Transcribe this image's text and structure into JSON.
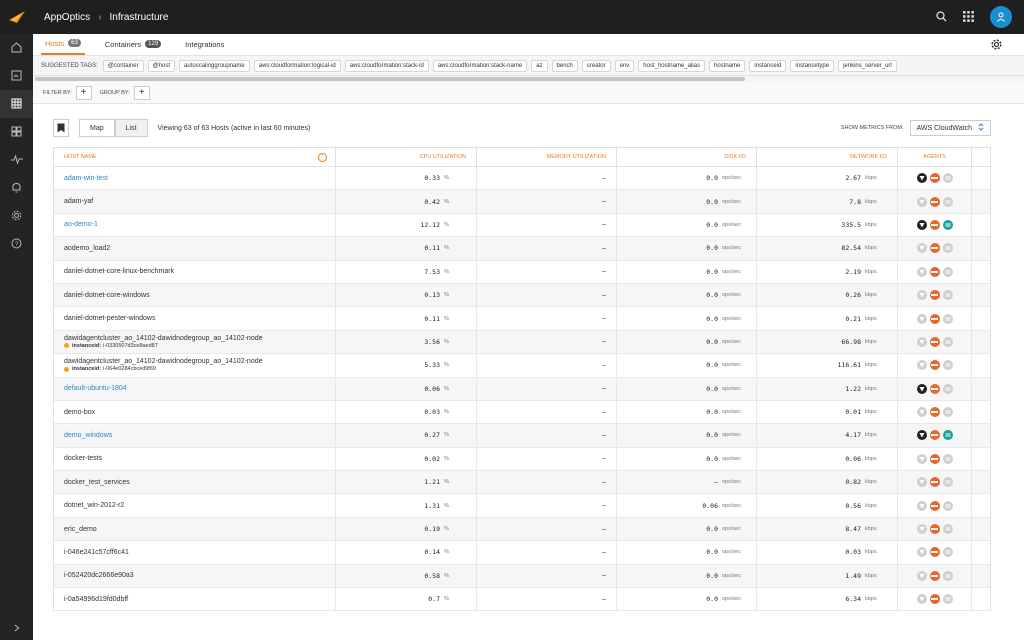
{
  "topbar": {
    "app_name": "AppOptics",
    "breadcrumb": "Infrastructure"
  },
  "colors": {
    "accent": "#e67e22",
    "link": "#2b87c9",
    "avatar": "#1a8fd0",
    "aws_agent": "#e8662c",
    "sw_agent": "#15a39a"
  },
  "sidebar": {
    "items": [
      "home-icon",
      "dashboard-icon",
      "infrastructure-icon",
      "services-icon",
      "metrics-icon",
      "alerts-icon",
      "settings-icon",
      "help-icon"
    ]
  },
  "tabs": [
    {
      "label": "Hosts",
      "count": "63"
    },
    {
      "label": "Containers",
      "count": "129"
    },
    {
      "label": "Integrations"
    }
  ],
  "tags": {
    "label": "SUGGESTED TAGS:",
    "items": [
      "@container",
      "@host",
      "autoscalinggroupname",
      "aws:cloudformation:logical-id",
      "aws:cloudformation:stack-id",
      "aws:cloudformation:stack-name",
      "az",
      "bench",
      "creator",
      "env",
      "host_hostname_alias",
      "hostname",
      "instanceid",
      "instancetype",
      "jenkins_server_url"
    ]
  },
  "filter": {
    "filter_label": "FILTER BY:",
    "group_label": "GROUP BY:",
    "plus": "+"
  },
  "toolbar": {
    "map_label": "Map",
    "list_label": "List",
    "summary": "Viewing 63 of 63 Hosts (active in last 60 minutes)",
    "metrics_label": "SHOW METRICS FROM:",
    "metrics_value": "AWS CloudWatch"
  },
  "table": {
    "headers": {
      "host": "HOST NAME",
      "cpu": "CPU UTILIZATION",
      "mem": "MEMORY UTILIZATION",
      "disk": "DISK I/O",
      "net": "NETWORK I/O",
      "agents": "AGENTS"
    },
    "rows": [
      {
        "name": "adam-win-test",
        "link": true,
        "cpu": "0.33",
        "cpu_unit": "%",
        "mem": "–",
        "disk": "0.0",
        "disk_unit": "ops/sec",
        "net": "2.67",
        "net_unit": "kbps",
        "agents": [
          "linux-on",
          "aws",
          "sw-off"
        ]
      },
      {
        "name": "adam-yaf",
        "link": false,
        "cpu": "0.42",
        "cpu_unit": "%",
        "mem": "–",
        "disk": "0.0",
        "disk_unit": "ops/sec",
        "net": "7.8",
        "net_unit": "kbps",
        "agents": [
          "linux-off",
          "aws",
          "sw-off"
        ]
      },
      {
        "name": "ao-demo-1",
        "link": true,
        "cpu": "12.12",
        "cpu_unit": "%",
        "mem": "–",
        "disk": "0.0",
        "disk_unit": "ops/sec",
        "net": "335.5",
        "net_unit": "kbps",
        "agents": [
          "linux-on",
          "aws",
          "sw-on"
        ]
      },
      {
        "name": "aodemo_load2",
        "link": false,
        "cpu": "0.11",
        "cpu_unit": "%",
        "mem": "–",
        "disk": "0.0",
        "disk_unit": "ops/sec",
        "net": "82.54",
        "net_unit": "kbps",
        "agents": [
          "linux-off",
          "aws",
          "sw-off"
        ]
      },
      {
        "name": "daniel-dotnet-core-linux-benchmark",
        "link": false,
        "cpu": "7.53",
        "cpu_unit": "%",
        "mem": "–",
        "disk": "0.0",
        "disk_unit": "ops/sec",
        "net": "2.19",
        "net_unit": "kbps",
        "agents": [
          "linux-off",
          "aws",
          "sw-off"
        ]
      },
      {
        "name": "daniel-dotnet-core-windows",
        "link": false,
        "cpu": "0.13",
        "cpu_unit": "%",
        "mem": "–",
        "disk": "0.0",
        "disk_unit": "ops/sec",
        "net": "0.26",
        "net_unit": "kbps",
        "agents": [
          "linux-off",
          "aws",
          "sw-off"
        ]
      },
      {
        "name": "daniel-dotnet-pester-windows",
        "link": false,
        "cpu": "0.11",
        "cpu_unit": "%",
        "mem": "–",
        "disk": "0.0",
        "disk_unit": "ops/sec",
        "net": "0.21",
        "net_unit": "kbps",
        "agents": [
          "linux-off",
          "aws",
          "sw-off"
        ]
      },
      {
        "name": "dawidagentcluster_ao_14102-dawidnodegroup_ao_14102-node",
        "link": false,
        "sub_key": "instanceid:",
        "sub_val": "i-0330507d3ce8aed87",
        "cpu": "3.56",
        "cpu_unit": "%",
        "mem": "–",
        "disk": "0.0",
        "disk_unit": "ops/sec",
        "net": "66.98",
        "net_unit": "kbps",
        "agents": [
          "linux-off",
          "aws",
          "sw-off"
        ]
      },
      {
        "name": "dawidagentcluster_ao_14102-dawidnodegroup_ao_14102-node",
        "link": false,
        "sub_key": "instanceid:",
        "sub_val": "i-064e0284cbced9f69",
        "cpu": "5.33",
        "cpu_unit": "%",
        "mem": "–",
        "disk": "0.0",
        "disk_unit": "ops/sec",
        "net": "116.61",
        "net_unit": "kbps",
        "agents": [
          "linux-off",
          "aws",
          "sw-off"
        ]
      },
      {
        "name": "default-ubuntu-1804",
        "link": true,
        "cpu": "0.06",
        "cpu_unit": "%",
        "mem": "–",
        "disk": "0.0",
        "disk_unit": "ops/sec",
        "net": "1.22",
        "net_unit": "kbps",
        "agents": [
          "linux-on",
          "aws",
          "sw-off"
        ]
      },
      {
        "name": "demo-box",
        "link": false,
        "cpu": "0.03",
        "cpu_unit": "%",
        "mem": "–",
        "disk": "0.0",
        "disk_unit": "ops/sec",
        "net": "0.01",
        "net_unit": "kbps",
        "agents": [
          "linux-off",
          "aws",
          "sw-off"
        ]
      },
      {
        "name": "demo_windows",
        "link": true,
        "cpu": "0.27",
        "cpu_unit": "%",
        "mem": "–",
        "disk": "0.0",
        "disk_unit": "ops/sec",
        "net": "4.17",
        "net_unit": "kbps",
        "agents": [
          "linux-on",
          "aws",
          "sw-on"
        ]
      },
      {
        "name": "docker-tests",
        "link": false,
        "cpu": "0.02",
        "cpu_unit": "%",
        "mem": "–",
        "disk": "0.0",
        "disk_unit": "ops/sec",
        "net": "0.06",
        "net_unit": "kbps",
        "agents": [
          "linux-off",
          "aws",
          "sw-off"
        ]
      },
      {
        "name": "docker_test_services",
        "link": false,
        "cpu": "1.21",
        "cpu_unit": "%",
        "mem": "–",
        "disk": "–",
        "disk_unit": "ops/sec",
        "net": "0.82",
        "net_unit": "kbps",
        "agents": [
          "linux-off",
          "aws",
          "sw-off"
        ]
      },
      {
        "name": "dotnet_win-2012-r2",
        "link": false,
        "cpu": "1.31",
        "cpu_unit": "%",
        "mem": "–",
        "disk": "0.06",
        "disk_unit": "ops/sec",
        "net": "0.56",
        "net_unit": "kbps",
        "agents": [
          "linux-off",
          "aws",
          "sw-off"
        ]
      },
      {
        "name": "eric_demo",
        "link": false,
        "cpu": "0.19",
        "cpu_unit": "%",
        "mem": "–",
        "disk": "0.0",
        "disk_unit": "ops/sec",
        "net": "8.47",
        "net_unit": "kbps",
        "agents": [
          "linux-off",
          "aws",
          "sw-off"
        ]
      },
      {
        "name": "i-046e241c57cff6c41",
        "link": false,
        "cpu": "0.14",
        "cpu_unit": "%",
        "mem": "–",
        "disk": "0.0",
        "disk_unit": "ops/sec",
        "net": "0.03",
        "net_unit": "kbps",
        "agents": [
          "linux-off",
          "aws",
          "sw-off"
        ]
      },
      {
        "name": "i-052420dc2666e90a3",
        "link": false,
        "cpu": "0.58",
        "cpu_unit": "%",
        "mem": "–",
        "disk": "0.0",
        "disk_unit": "ops/sec",
        "net": "1.49",
        "net_unit": "kbps",
        "agents": [
          "linux-off",
          "aws",
          "sw-off"
        ]
      },
      {
        "name": "i-0a54996d19fd0dbff",
        "link": false,
        "cpu": "0.7",
        "cpu_unit": "%",
        "mem": "–",
        "disk": "0.0",
        "disk_unit": "ops/sec",
        "net": "6.34",
        "net_unit": "kbps",
        "agents": [
          "linux-off",
          "aws",
          "sw-off"
        ]
      }
    ]
  }
}
